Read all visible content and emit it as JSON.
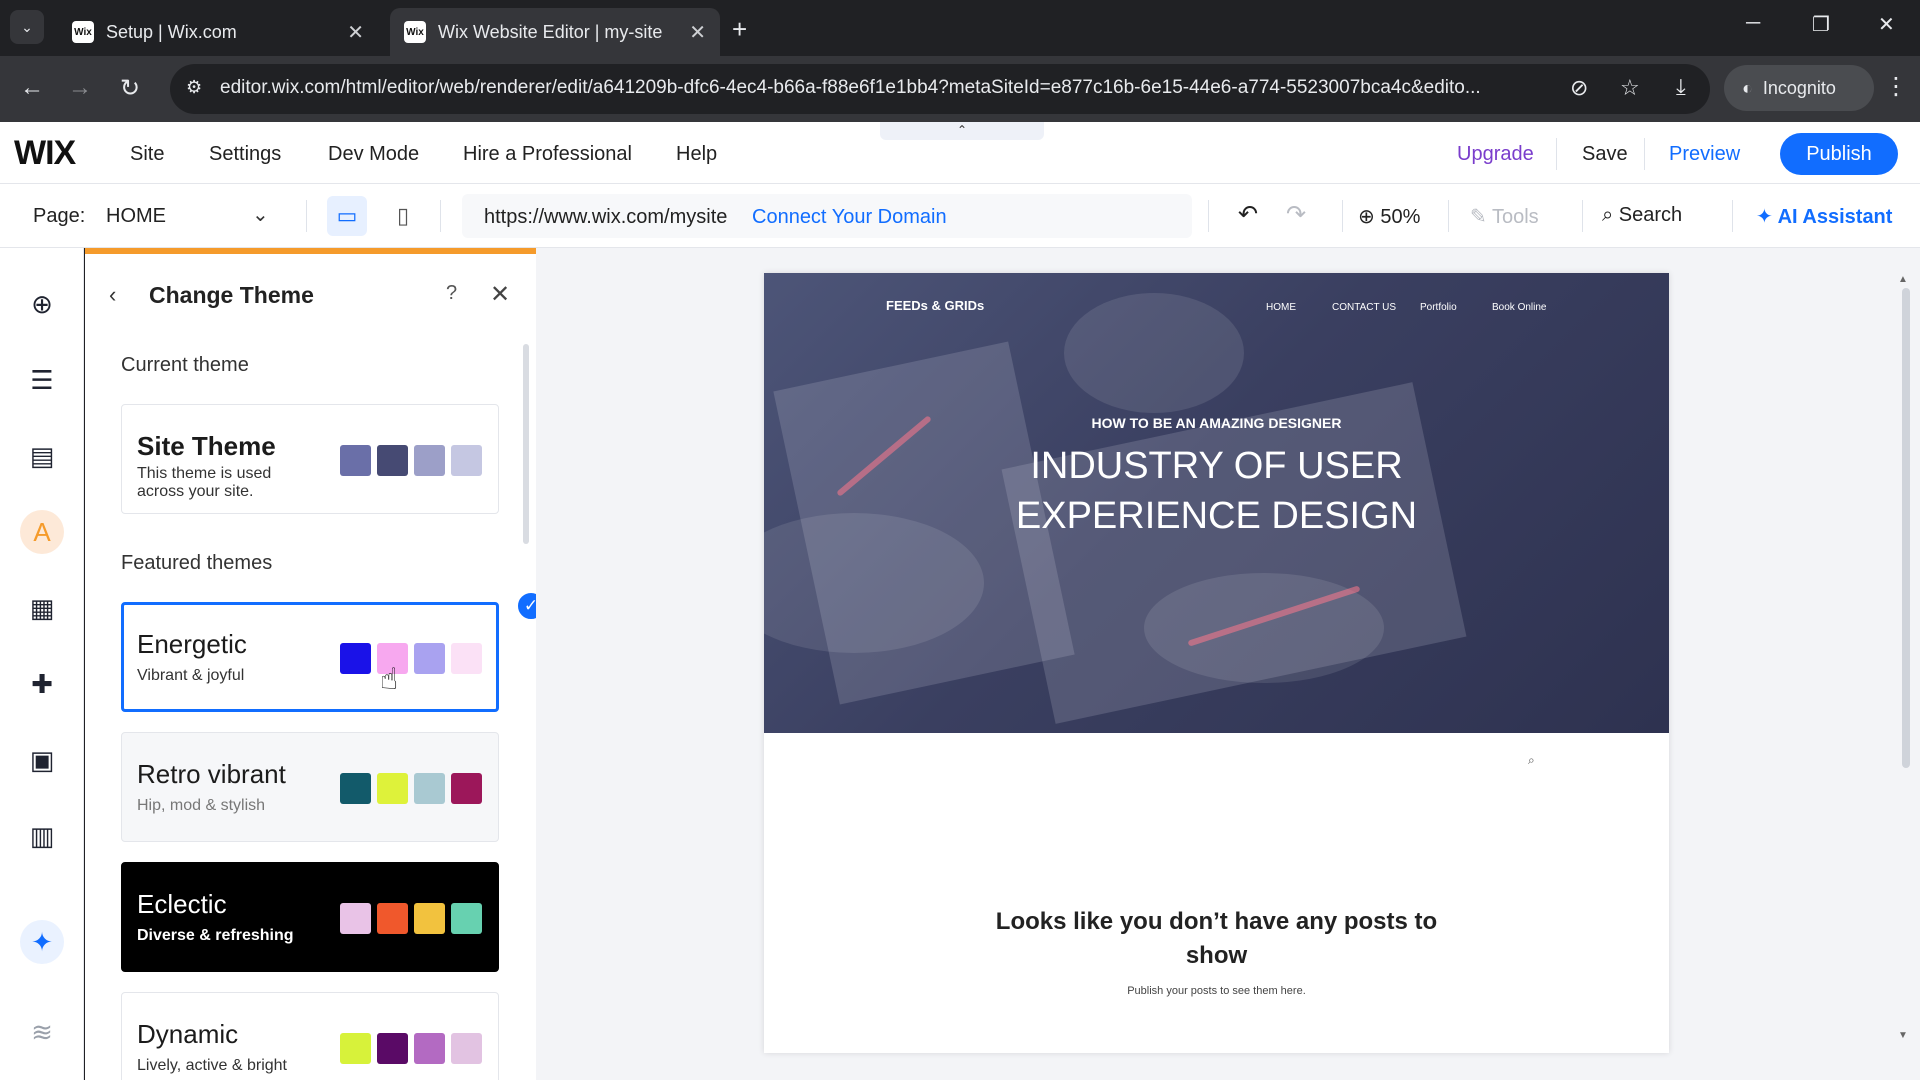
{
  "browser": {
    "tabs": [
      {
        "favicon": "Wix",
        "title": "Setup | Wix.com"
      },
      {
        "favicon": "Wix",
        "title": "Wix Website Editor | my-site"
      }
    ],
    "url": "editor.wix.com/html/editor/web/renderer/edit/a641209b-dfc6-4ec4-b66a-f88e6f1e1bb4?metaSiteId=e877c16b-6e15-44e6-a774-5523007bca4c&edito...",
    "incognito_label": "Incognito"
  },
  "wix_top": {
    "logo": "WIX",
    "menu": [
      "Site",
      "Settings",
      "Dev Mode",
      "Hire a Professional",
      "Help"
    ],
    "upgrade": "Upgrade",
    "save": "Save",
    "preview": "Preview",
    "publish": "Publish"
  },
  "toolbar": {
    "page_label": "Page:",
    "page_value": "HOME",
    "site_url": "https://www.wix.com/mysite",
    "connect_domain": "Connect Your Domain",
    "zoom": "50%",
    "tools": "Tools",
    "search": "Search",
    "ai_assistant": "AI Assistant"
  },
  "panel": {
    "title": "Change Theme",
    "current_label": "Current theme",
    "featured_label": "Featured themes",
    "current": {
      "name": "Site Theme",
      "desc": "This theme is used across your site.",
      "colors": [
        "#6a6fa8",
        "#464a73",
        "#9c9fc8",
        "#c5c7e2"
      ]
    },
    "themes": [
      {
        "name": "Energetic",
        "desc": "Vibrant & joyful",
        "colors": [
          "#1a12e8",
          "#f7a8ef",
          "#a9a2f0",
          "#fbe1f6"
        ]
      },
      {
        "name": "Retro vibrant",
        "desc": "Hip, mod & stylish",
        "colors": [
          "#125a6a",
          "#def23a",
          "#a9c9d2",
          "#9c175a"
        ]
      },
      {
        "name": "Eclectic",
        "desc": "Diverse & refreshing",
        "colors": [
          "#e9c3e7",
          "#f0582c",
          "#f2c23e",
          "#67d1b0"
        ]
      },
      {
        "name": "Dynamic",
        "desc": "Lively, active & bright",
        "colors": [
          "#d7f23a",
          "#5a0a66",
          "#b36ac2",
          "#e2c3e2"
        ]
      }
    ]
  },
  "site_preview": {
    "logo": "FEEDs & GRIDs",
    "nav": [
      "HOME",
      "CONTACT US",
      "Portfolio",
      "Book Online"
    ],
    "kicker": "HOW TO BE AN AMAZING DESIGNER",
    "title_line1": "INDUSTRY OF USER",
    "title_line2": "EXPERIENCE DESIGN",
    "empty_line1": "Looks like you don’t have any posts to",
    "empty_line2": "show",
    "empty_sub": "Publish your posts to see them here."
  }
}
